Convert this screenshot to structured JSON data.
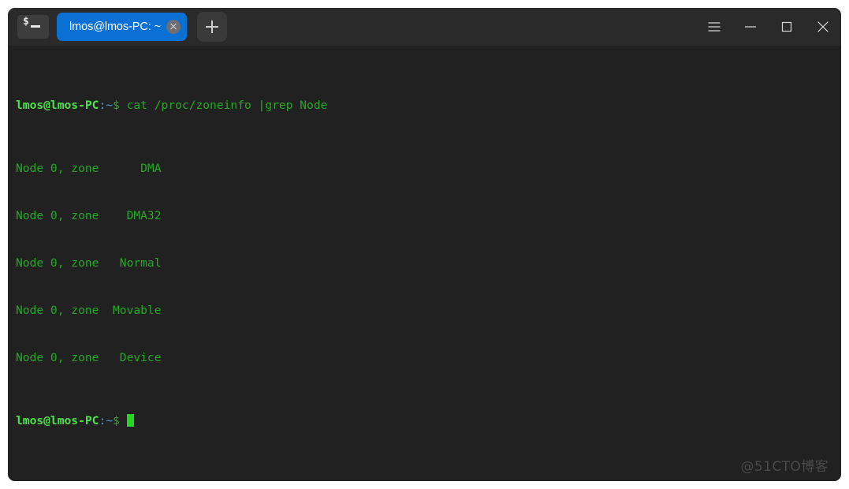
{
  "window": {
    "app_icon_glyph": "$",
    "background_color": "#212121",
    "titlebar_color": "#2a2a2a"
  },
  "titlebar": {
    "tabs": [
      {
        "label": "lmos@lmos-PC: ~",
        "active": true,
        "close_label": "×"
      }
    ],
    "new_tab_label": "+",
    "controls": [
      {
        "name": "menu",
        "glyph": "☰"
      },
      {
        "name": "minimize",
        "glyph": "─"
      },
      {
        "name": "maximize",
        "glyph": "□"
      },
      {
        "name": "close",
        "glyph": "✕"
      }
    ]
  },
  "terminal": {
    "prompt": {
      "user_host": "lmos@lmos-PC",
      "colon": ":",
      "path": "~",
      "symbol": "$"
    },
    "command": " cat /proc/zoneinfo |grep Node",
    "output_lines": [
      "Node 0, zone      DMA",
      "Node 0, zone    DMA32",
      "Node 0, zone   Normal",
      "Node 0, zone  Movable",
      "Node 0, zone   Device"
    ],
    "colors": {
      "user_host": "#4ee04e",
      "path": "#4a9ad4",
      "command": "#26a828",
      "output": "#26a828",
      "cursor": "#27d427"
    }
  },
  "watermark": {
    "text": "@51CTO博客"
  }
}
